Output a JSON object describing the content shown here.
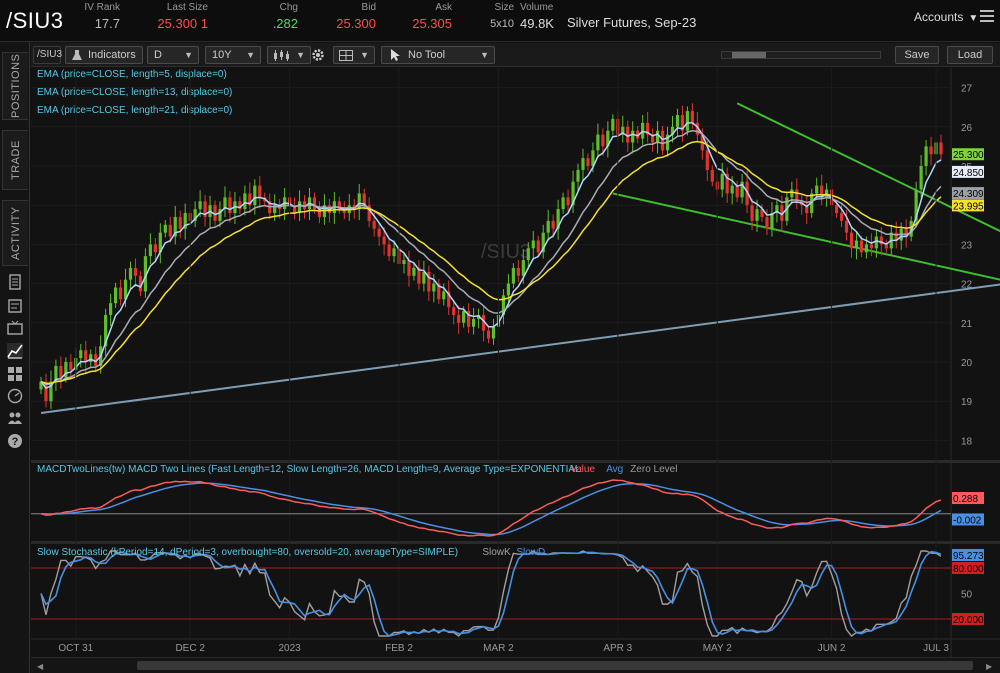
{
  "header": {
    "symbol": "/SIU3",
    "quote_fields": [
      {
        "label": "IV Rank",
        "value": "17.7",
        "color": "#bbbbbb"
      },
      {
        "label": "Last Size",
        "value": "25.300 1",
        "color": "#ff4d4d"
      },
      {
        "label": "Chg",
        "value": ".282",
        "color": "#4cd964"
      },
      {
        "label": "Bid",
        "value": "25.300",
        "color": "#ff4d4d"
      },
      {
        "label": "Ask",
        "value": "25.305",
        "color": "#ff4d4d"
      },
      {
        "label": "Size",
        "value": "5x10",
        "color": "#bbbbbb"
      },
      {
        "label": "Volume",
        "value": "49.8K",
        "color": "#dddddd"
      }
    ],
    "description": "Silver Futures, Sep-23",
    "accounts_label": "Accounts"
  },
  "side_tabs": [
    "POSITIONS",
    "TRADE",
    "ACTIVITY"
  ],
  "side_icons": [
    "document-icon",
    "notes-icon",
    "tv-icon",
    "chart-icon",
    "grid-icon",
    "gauge-icon",
    "people-icon",
    "help-icon"
  ],
  "toolbar": {
    "symbol_input": "/SIU3",
    "indicators_label": "Indicators",
    "period": "D",
    "range": "10Y",
    "tool_label": "No Tool",
    "save_label": "Save",
    "load_label": "Load"
  },
  "chart_data": [
    {
      "type": "candlestick",
      "watermark": "/SIU3",
      "studies": [
        {
          "label": "EMA (price=CLOSE, length=5, displace=0)",
          "color": "#b0d8ff"
        },
        {
          "label": "EMA (price=CLOSE, length=13, displace=0)",
          "color": "#a8adb8"
        },
        {
          "label": "EMA (price=CLOSE, length=21, displace=0)",
          "color": "#f5e12a"
        }
      ],
      "ylim": [
        17.5,
        27.5
      ],
      "y_ticks": [
        18,
        19,
        20,
        21,
        22,
        23,
        24,
        25,
        26,
        27
      ],
      "x_ticks": [
        "OCT 31",
        "DEC 2",
        "2023",
        "FEB 2",
        "MAR 2",
        "APR 3",
        "MAY 2",
        "JUN 2",
        "JUL 3"
      ],
      "x_tick_index": [
        7,
        30,
        50,
        72,
        92,
        116,
        136,
        159,
        180
      ],
      "price_labels": [
        {
          "text": "25.300",
          "value": 25.3,
          "bg": "#7fd23a",
          "fg": "#000000"
        },
        {
          "text": "24.850",
          "value": 24.85,
          "bg": "#e8eef8",
          "fg": "#000000"
        },
        {
          "text": "24.309",
          "value": 24.309,
          "bg": "#9aa0a8",
          "fg": "#000000"
        },
        {
          "text": "23.995",
          "value": 23.995,
          "bg": "#f5e12a",
          "fg": "#000000"
        }
      ],
      "closes": [
        19.5,
        19.0,
        19.5,
        19.9,
        19.6,
        20.0,
        19.8,
        20.1,
        20.3,
        20.0,
        20.2,
        19.9,
        20.4,
        21.2,
        21.5,
        21.9,
        21.6,
        22.1,
        22.4,
        22.2,
        21.8,
        22.7,
        23.0,
        22.8,
        23.3,
        23.5,
        23.2,
        23.7,
        23.4,
        23.8,
        23.6,
        23.9,
        24.1,
        23.7,
        24.0,
        23.6,
        23.9,
        24.2,
        23.8,
        24.1,
        23.9,
        24.3,
        24.0,
        24.5,
        24.2,
        24.1,
        23.8,
        24.0,
        23.9,
        24.2,
        24.0,
        23.8,
        24.1,
        23.9,
        24.2,
        23.9,
        23.7,
        24.0,
        23.8,
        24.1,
        23.9,
        23.8,
        24.0,
        23.9,
        24.3,
        24.0,
        23.6,
        23.4,
        23.2,
        23.0,
        22.7,
        22.9,
        22.5,
        22.6,
        22.2,
        22.4,
        22.0,
        22.3,
        21.8,
        22.0,
        21.6,
        21.8,
        21.4,
        21.2,
        21.0,
        21.3,
        20.9,
        21.1,
        21.2,
        20.8,
        20.6,
        20.9,
        21.2,
        21.7,
        22.0,
        22.4,
        22.2,
        22.6,
        22.9,
        23.1,
        22.8,
        23.3,
        23.6,
        23.4,
        23.9,
        24.2,
        24.0,
        24.6,
        24.9,
        25.2,
        25.0,
        25.4,
        25.8,
        25.5,
        25.9,
        26.2,
        25.8,
        26.0,
        25.6,
        25.9,
        25.7,
        26.1,
        25.8,
        25.6,
        25.9,
        25.4,
        25.8,
        26.0,
        26.3,
        25.9,
        26.4,
        26.1,
        25.8,
        25.4,
        24.9,
        24.6,
        24.4,
        24.8,
        24.3,
        24.5,
        24.2,
        24.6,
        24.0,
        23.6,
        23.9,
        23.7,
        23.4,
        23.8,
        24.0,
        23.6,
        24.2,
        24.4,
        24.1,
        24.0,
        23.8,
        24.3,
        24.5,
        24.2,
        24.4,
        24.0,
        23.8,
        23.6,
        23.3,
        22.9,
        23.1,
        22.8,
        23.0,
        22.9,
        23.2,
        23.0,
        22.9,
        23.3,
        23.1,
        23.4,
        23.2,
        23.6,
        24.4,
        25.0,
        25.5,
        25.3,
        25.6,
        25.3
      ],
      "trendlines": [
        {
          "name": "support",
          "from": [
            0,
            18.7
          ],
          "to": [
            194,
            22.1
          ],
          "color": "#7f9eb3"
        },
        {
          "name": "upper-wedge",
          "from": [
            140,
            26.6
          ],
          "to": [
            194,
            22.9
          ],
          "color": "#3fbf2f"
        },
        {
          "name": "lower-wedge",
          "from": [
            115,
            24.3
          ],
          "to": [
            194,
            21.9
          ],
          "color": "#3fbf2f"
        }
      ]
    },
    {
      "type": "line",
      "label": "MACDTwoLines(tw) MACD Two Lines (Fast Length=12, Slow Length=26, MACD Length=9, Average Type=EXPONENTIAL",
      "legend": [
        {
          "text": "Value",
          "color": "#ff5a5a"
        },
        {
          "text": "Avg",
          "color": "#4a90e2"
        },
        {
          "text": "Zero Level",
          "color": "#999999"
        }
      ],
      "price_labels": [
        {
          "text": "0.288",
          "value": 0.288,
          "bg": "#ff5a5a",
          "fg": "#000000"
        },
        {
          "text": "-0.002",
          "value": -0.002,
          "bg": "#4a90e2",
          "fg": "#000000"
        }
      ]
    },
    {
      "type": "line",
      "label": "Slow Stochastic (kPeriod=14, dPeriod=3, overbought=80, oversold=20, averageType=SIMPLE)",
      "legend": [
        {
          "text": "SlowK",
          "color": "#a0a0a0"
        },
        {
          "text": "SlowD",
          "color": "#4a90e2"
        }
      ],
      "y_ticks": [
        50
      ],
      "price_labels": [
        {
          "text": "95.273",
          "value": 95.273,
          "bg": "#4a90e2",
          "fg": "#000000"
        },
        {
          "text": "80.000",
          "value": 80,
          "bg": "#cc2222",
          "fg": "#000000"
        },
        {
          "text": "20.000",
          "value": 20,
          "bg": "#cc2222",
          "fg": "#000000"
        }
      ]
    }
  ]
}
